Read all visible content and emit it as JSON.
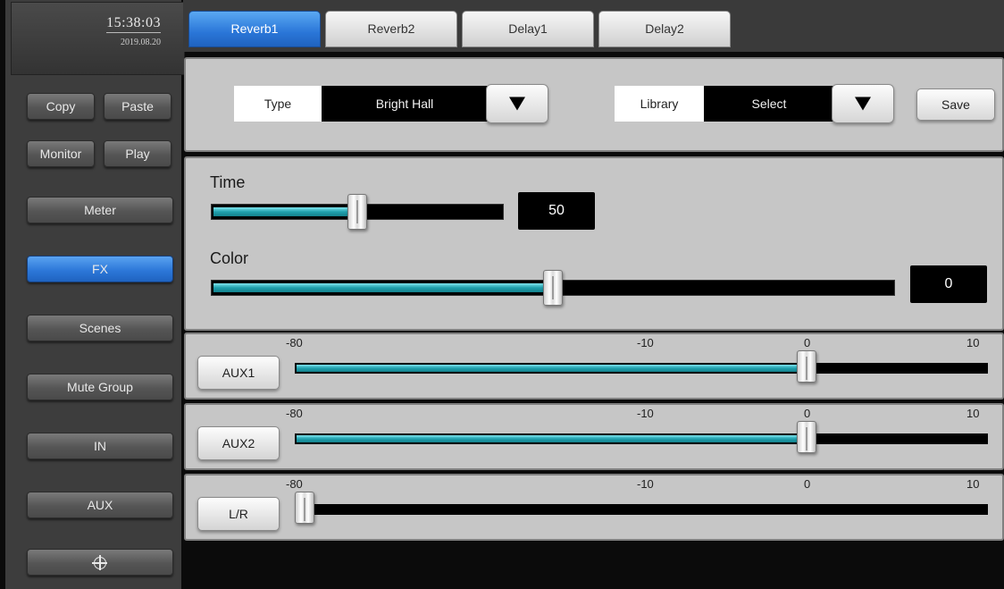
{
  "clock": {
    "time": "15:38:03",
    "date": "2019.08.20"
  },
  "sidebar": {
    "copy": "Copy",
    "paste": "Paste",
    "monitor": "Monitor",
    "play": "Play",
    "meter": "Meter",
    "fx": "FX",
    "scenes": "Scenes",
    "mute_group": "Mute Group",
    "in": "IN",
    "aux": "AUX",
    "bottom_icon": "crosshair-icon"
  },
  "tabs": [
    "Reverb1",
    "Reverb2",
    "Delay1",
    "Delay2"
  ],
  "active_tab": "Reverb1",
  "preset": {
    "type_label": "Type",
    "type_value": "Bright Hall",
    "library_label": "Library",
    "library_value": "Select",
    "save_label": "Save"
  },
  "params": {
    "time": {
      "label": "Time",
      "value": "50",
      "level": 0.5
    },
    "color": {
      "label": "Color",
      "value": "0",
      "level": 0.5
    }
  },
  "sends": {
    "scale": [
      "-80",
      "-10",
      "0",
      "10"
    ],
    "aux1": {
      "label": "AUX1",
      "level_db": 0
    },
    "aux2": {
      "label": "AUX2",
      "level_db": 0
    },
    "lr": {
      "label": "L/R",
      "level_db": -80
    }
  },
  "colors": {
    "active_blue": "#2d78d9",
    "fill_teal": "#1fa0ad",
    "panel_gray": "#c6c6c6"
  }
}
